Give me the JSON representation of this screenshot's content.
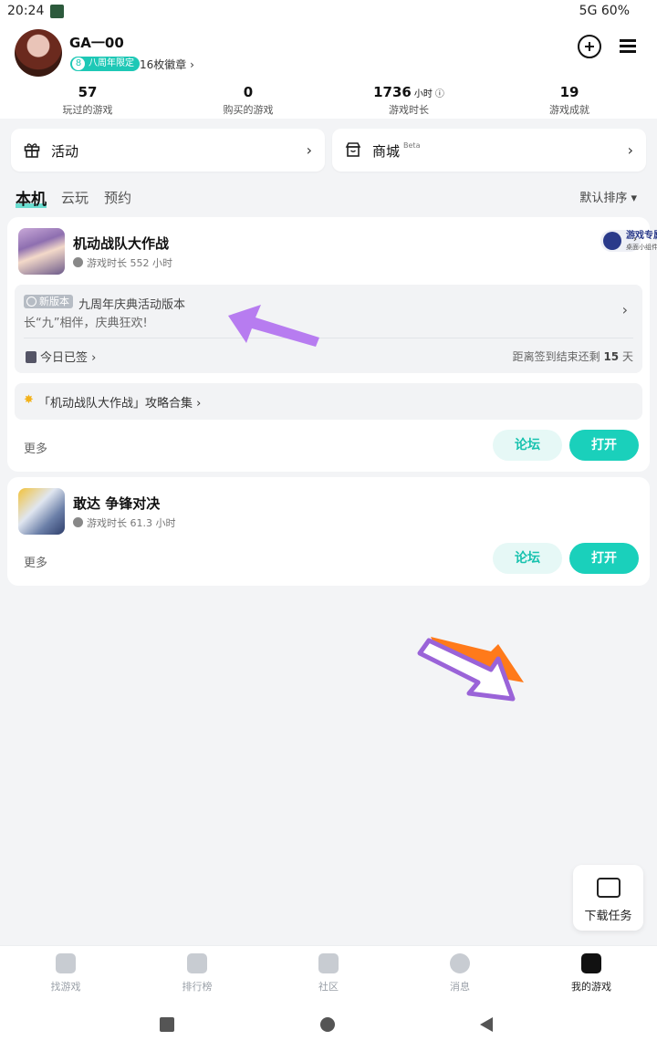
{
  "status_bar": {
    "time": "20:24",
    "right_text": "5G 60%"
  },
  "profile": {
    "username": "GA一00",
    "badge_num": "8",
    "badge_label": "八周年限定",
    "medal_count": "16枚徽章 ›"
  },
  "stats": [
    {
      "value": "57",
      "unit": "",
      "label": "玩过的游戏"
    },
    {
      "value": "0",
      "unit": "",
      "label": "购买的游戏"
    },
    {
      "value": "1736",
      "unit": "小时",
      "label": "游戏时长"
    },
    {
      "value": "19",
      "unit": "",
      "label": "游戏成就"
    }
  ],
  "quick_links": {
    "activity": {
      "label": "活动",
      "icon": "gift-icon"
    },
    "store": {
      "label": "商城",
      "beta": "Beta",
      "icon": "store-icon"
    }
  },
  "tabs": {
    "local": "本机",
    "cloud": "云玩",
    "reserve": "预约",
    "sort": "默认排序 ▾"
  },
  "games": [
    {
      "name": "机动战队大作战",
      "playtime": "游戏时长 552 小时",
      "widget": {
        "title": "游戏专属",
        "subtitle": "桌面小组件"
      },
      "event": {
        "tag": "新版本",
        "title": "九周年庆典活动版本",
        "subtitle": "长“九”相伴，庆典狂欢!",
        "checkin": "今日已签 ›",
        "remaining_prefix": "距离签到结束还剩",
        "remaining_days": "15",
        "remaining_suffix": "天"
      },
      "guide": "「机动战队大作战」攻略合集 ›",
      "more": "更多",
      "forum": "论坛",
      "open": "打开"
    },
    {
      "name": "敢达 争锋对决",
      "playtime": "游戏时长 61.3 小时",
      "more": "更多",
      "forum": "论坛",
      "open": "打开"
    }
  ],
  "download_task": "下载任务",
  "bottom_nav": [
    {
      "label": "找游戏",
      "icon": "find-game-icon"
    },
    {
      "label": "排行榜",
      "icon": "ranking-icon"
    },
    {
      "label": "社区",
      "icon": "community-icon"
    },
    {
      "label": "消息",
      "icon": "message-icon"
    },
    {
      "label": "我的游戏",
      "icon": "my-games-icon"
    }
  ],
  "colors": {
    "accent": "#1ad0bb",
    "annotation_purple": "#b77cf0",
    "annotation_orange": "#ff7a1a"
  }
}
